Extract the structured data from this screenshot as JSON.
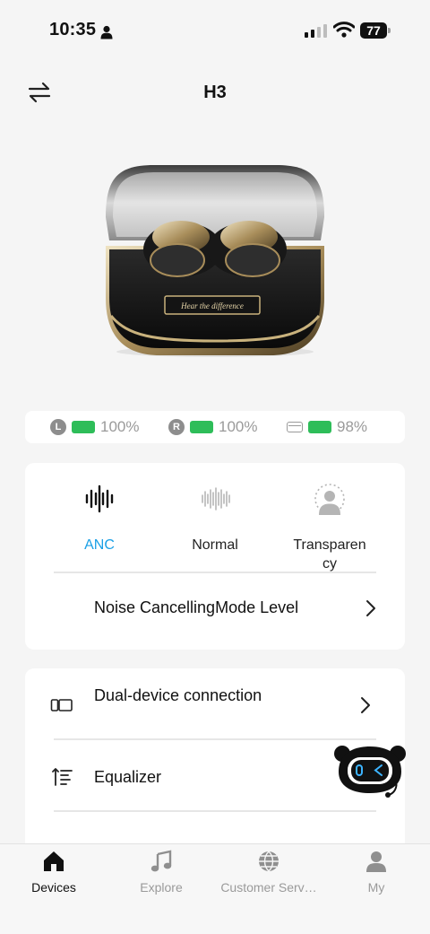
{
  "status_bar": {
    "time": "10:35",
    "battery": "77"
  },
  "header": {
    "title": "H3"
  },
  "product_image": {
    "caption": "Hear the difference"
  },
  "battery_levels": {
    "left": {
      "badge": "L",
      "value": "100%"
    },
    "right": {
      "badge": "R",
      "value": "100%"
    },
    "case": {
      "value": "98%"
    }
  },
  "modes": {
    "items": [
      {
        "label": "ANC",
        "active": true
      },
      {
        "label": "Normal",
        "active": false
      },
      {
        "label": "Transparen\ncy",
        "active": false
      }
    ],
    "level_row": "Noise CancellingMode Level"
  },
  "settings": {
    "items": [
      {
        "label": "Dual-device connection"
      },
      {
        "label": "Equalizer"
      }
    ]
  },
  "bottom_nav": {
    "items": [
      {
        "label": "Devices"
      },
      {
        "label": "Explore"
      },
      {
        "label": "Customer Serv…"
      },
      {
        "label": "My"
      }
    ]
  },
  "colors": {
    "accent": "#1aa0e6",
    "battery_green": "#2ebd59",
    "background": "#f5f5f5",
    "card": "#ffffff"
  }
}
